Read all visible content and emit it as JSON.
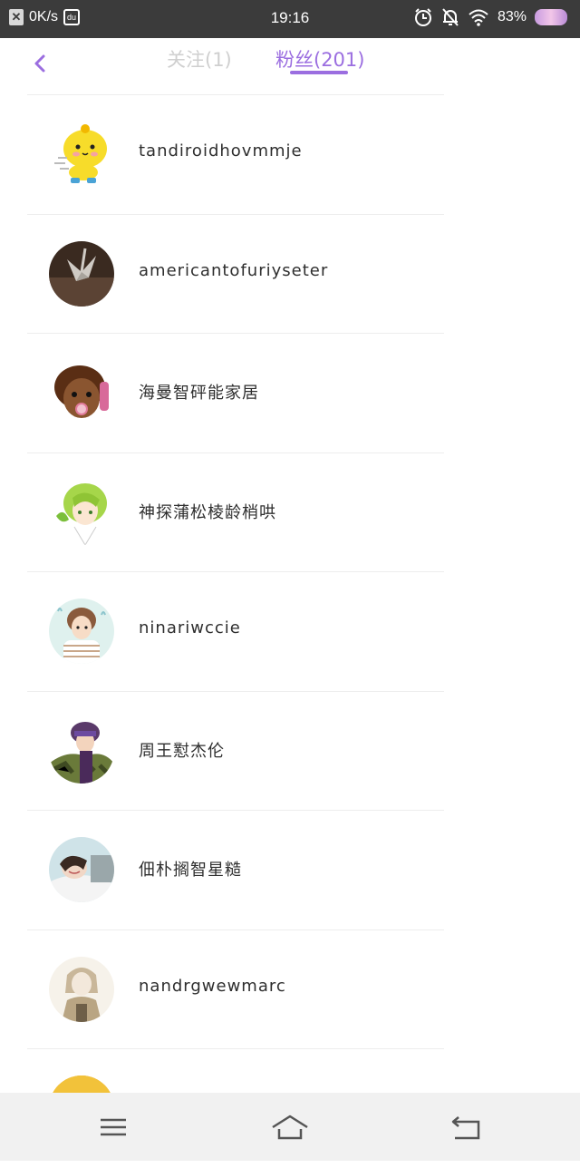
{
  "status_bar": {
    "net_speed": "0K/s",
    "du_icon_text": "du",
    "time": "19:16",
    "battery": "83%"
  },
  "header": {
    "tabs": [
      {
        "label": "关注(1)"
      },
      {
        "label": "粉丝(201)"
      }
    ],
    "accent_color": "#9b6ee0",
    "inactive_color": "#cfcfcf"
  },
  "followers": [
    {
      "name": "tandiroidhovmmje",
      "avatar": "yellow-chick"
    },
    {
      "name": "americantofuriyseter",
      "avatar": "paper-crane"
    },
    {
      "name": "海曼智砰能家居",
      "avatar": "cartoon-girl-brown"
    },
    {
      "name": "神探蒲松棱龄梢哄",
      "avatar": "green-hair-anime"
    },
    {
      "name": "ninariwccie",
      "avatar": "boy-striped-shirt"
    },
    {
      "name": "周王懟杰伦",
      "avatar": "camo-anime"
    },
    {
      "name": "佃朴搁智星糙",
      "avatar": "sleeping-girl"
    },
    {
      "name": "nandrgwewmarc",
      "avatar": "sketch-girl"
    },
    {
      "name": "",
      "avatar": "ninja-partial"
    }
  ]
}
